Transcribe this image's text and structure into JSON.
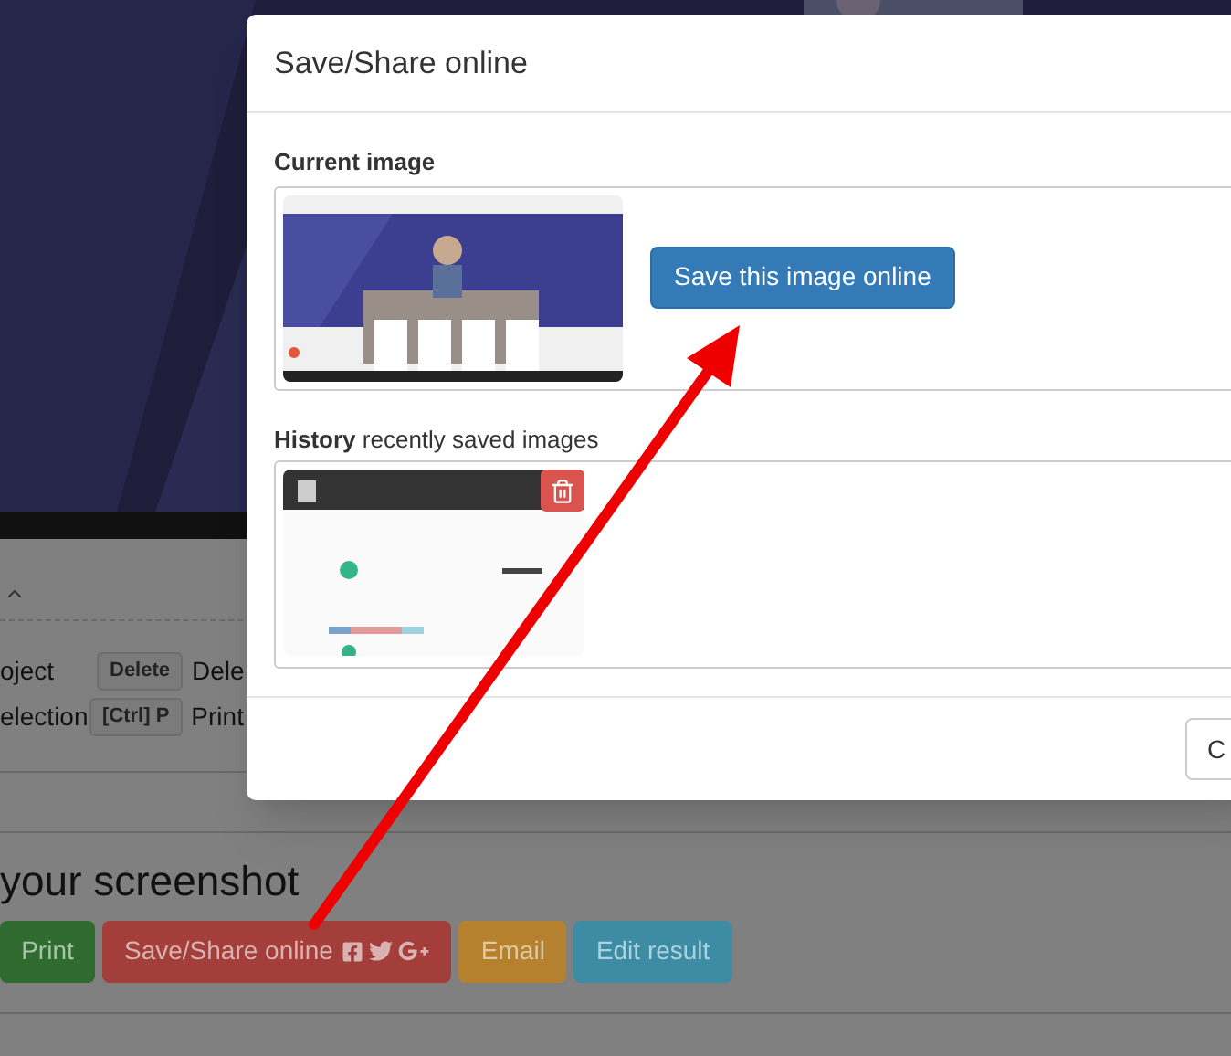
{
  "page": {
    "shortcuts": [
      {
        "label": "oject",
        "key": "Delete",
        "description": "Dele"
      },
      {
        "label": "election",
        "key": "[Ctrl] P",
        "description": "Print"
      }
    ],
    "heading": "your screenshot",
    "buttons": [
      {
        "label": "Print",
        "kind": "print"
      },
      {
        "label": "Save/Share online",
        "kind": "share"
      },
      {
        "label": "Email",
        "kind": "email"
      },
      {
        "label": "Edit result",
        "kind": "edit"
      }
    ]
  },
  "dialog": {
    "title": "Save/Share online",
    "current": {
      "heading": "Current image",
      "button": "Save this image online"
    },
    "history": {
      "heading": "**History** recently saved images"
    },
    "footer_button": "C"
  }
}
